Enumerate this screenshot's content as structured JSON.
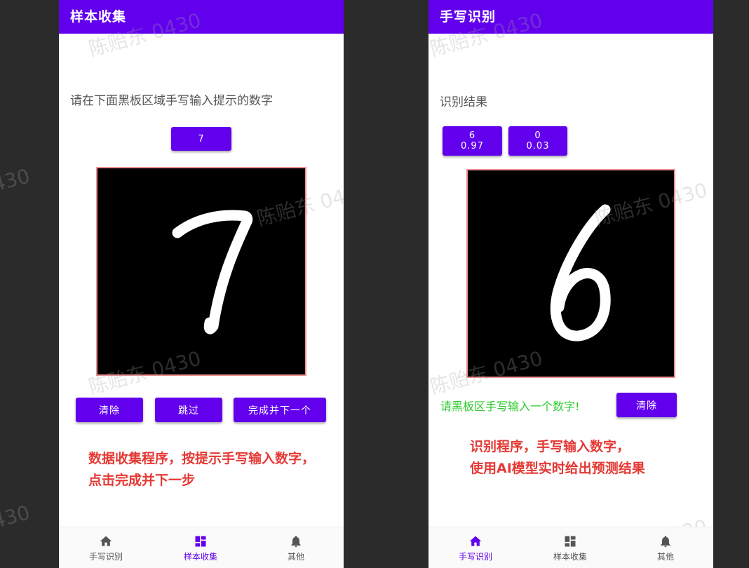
{
  "left": {
    "title": "样本收集",
    "prompt": "请在下面黑板区域手写输入提示的数字",
    "target_digit": "7",
    "board_digit": "7",
    "buttons": {
      "clear": "清除",
      "skip": "跳过",
      "done_next": "完成并下一个"
    },
    "note_line1": "数据收集程序，按提示手写输入数字，",
    "note_line2": "点击完成并下一步"
  },
  "right": {
    "title": "手写识别",
    "result_label": "识别结果",
    "results": [
      {
        "digit": "6",
        "prob": "0.97"
      },
      {
        "digit": "0",
        "prob": "0.03"
      }
    ],
    "board_digit": "6",
    "hint": "请黑板区手写输入一个数字!",
    "clear": "清除",
    "note_line1": "识别程序，手写输入数字，",
    "note_line2": "使用AI模型实时给出预测结果"
  },
  "nav": {
    "recognize": "手写识别",
    "collect": "样本收集",
    "other": "其他"
  },
  "watermark": "陈贻东 0430",
  "colors": {
    "primary": "#6200ee",
    "board": "#000000",
    "note_red": "#e53935",
    "hint_green": "#2ecc2e",
    "backdrop": "#2b2b2b"
  },
  "icons": [
    "home-icon",
    "dashboard-icon",
    "bell-icon"
  ]
}
